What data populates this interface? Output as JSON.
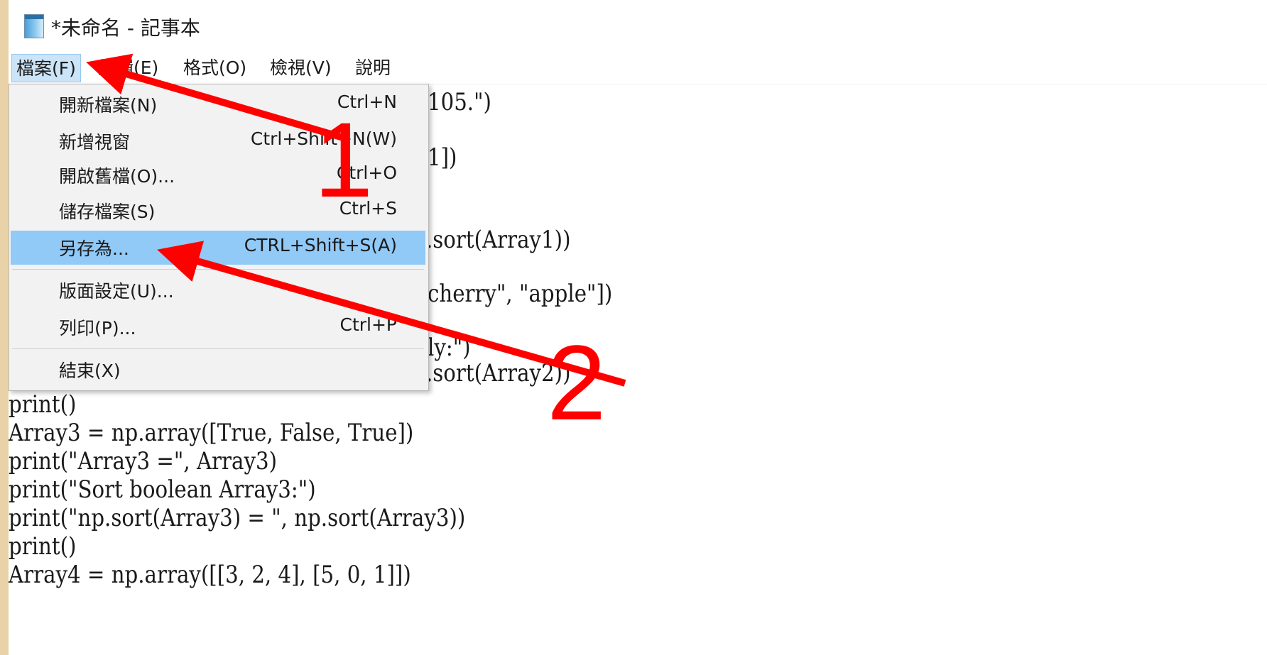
{
  "window": {
    "title": "*未命名 - 記事本",
    "app_icon": "notepad-icon"
  },
  "menubar": {
    "items": [
      "檔案(F)",
      "編輯(E)",
      "格式(O)",
      "檢視(V)",
      "說明"
    ]
  },
  "file_menu": {
    "items": [
      {
        "label": "開新檔案(N)",
        "shortcut": "Ctrl+N"
      },
      {
        "label": "新增視窗",
        "shortcut": "Ctrl+Shift+N(W)"
      },
      {
        "label": "開啟舊檔(O)...",
        "shortcut": "Ctrl+O"
      },
      {
        "label": "儲存檔案(S)",
        "shortcut": "Ctrl+S"
      },
      {
        "label": "另存為...",
        "shortcut": "CTRL+Shift+S(A)"
      },
      {
        "label": "版面設定(U)...",
        "shortcut": ""
      },
      {
        "label": "列印(P)...",
        "shortcut": "Ctrl+P"
      },
      {
        "label": "結束(X)",
        "shortcut": ""
      }
    ],
    "highlighted": "另存為..."
  },
  "editor": {
    "partial_lines": [
      "105.\")",
      "1])",
      ".sort(Array1))",
      "cherry\", \"apple\"])",
      "ly:\")",
      ".sort(Array2))"
    ],
    "lines": [
      "print()",
      "Array3 = np.array([True, False, True])",
      "print(\"Array3 =\", Array3)",
      "print(\"Sort boolean Array3:\")",
      "print(\"np.sort(Array3) = \", np.sort(Array3))",
      "print()",
      "Array4 = np.array([[3, 2, 4], [5, 0, 1]])"
    ]
  },
  "annotations": {
    "step1": "1",
    "step2": "2",
    "color": "#ff0000"
  }
}
